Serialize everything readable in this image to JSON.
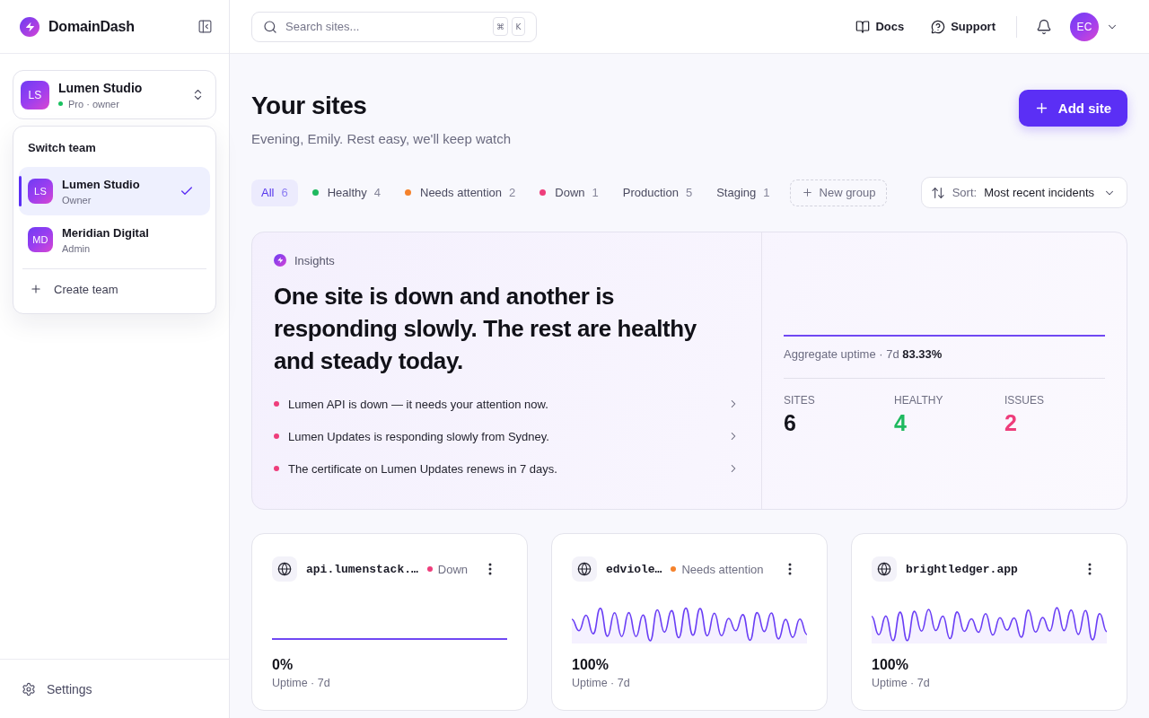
{
  "sidebar": {
    "brand": "DomainDash",
    "team_switcher": {
      "initials": "LS",
      "name": "Lumen Studio",
      "plan": "Pro · owner"
    },
    "team_menu": {
      "title": "Switch team",
      "teams": [
        {
          "initials": "LS",
          "name": "Lumen Studio",
          "role": "Owner",
          "selected": true
        },
        {
          "initials": "MD",
          "name": "Meridian Digital",
          "role": "Admin",
          "selected": false
        }
      ],
      "create_label": "Create team"
    },
    "settings_label": "Settings"
  },
  "topbar": {
    "search": {
      "placeholder": "Search sites...",
      "shortcut": [
        "⌘",
        "K"
      ]
    },
    "links": [
      {
        "kind": "docs",
        "label": "Docs"
      },
      {
        "kind": "support",
        "label": "Support"
      }
    ],
    "user_initials": "EC"
  },
  "header": {
    "title": "Your sites",
    "subtitle": "Evening, Emily. Rest easy, we'll keep watch",
    "add_button": "Add site"
  },
  "filters": {
    "tabs": [
      {
        "label": "All",
        "count": "6",
        "selected": true
      },
      {
        "label": "Healthy",
        "count": "4",
        "color": "#1fb95f",
        "selected": false
      },
      {
        "label": "Needs attention",
        "count": "2",
        "color": "#f5822c",
        "selected": false
      },
      {
        "label": "Down",
        "count": "1",
        "color": "#ee3d7b",
        "selected": false
      },
      {
        "label": "Production",
        "count": "5",
        "selected": false
      },
      {
        "label": "Staging",
        "count": "1",
        "selected": false
      }
    ],
    "new_group": "New group",
    "sort": {
      "label": "Sort:",
      "value": "Most recent incidents"
    }
  },
  "insights": {
    "label": "Insights",
    "headline": "One site is down and another is responding slowly. The rest are healthy and steady today.",
    "items": [
      "Lumen API is down — it needs your attention now.",
      "Lumen Updates is responding slowly from Sydney.",
      "The certificate on Lumen Updates renews in 7 days."
    ],
    "aggregate": {
      "kind": "flat",
      "caption": "Aggregate uptime · 7d **83.33%**"
    },
    "stats": [
      {
        "label": "SITES",
        "value": "6",
        "color": "#14141c"
      },
      {
        "label": "HEALTHY",
        "value": "4",
        "color": "#1fb95f"
      },
      {
        "label": "ISSUES",
        "value": "2",
        "color": "#ee3d7b"
      }
    ]
  },
  "sites": [
    {
      "kind": "flat",
      "domain": "api.lumenstack.…",
      "status": {
        "label": "Down",
        "color": "#ee3d7b"
      },
      "uptime": "0%",
      "uptime_label": "Uptime · 7d"
    },
    {
      "kind": "wave",
      "domain": "edviole…",
      "status": {
        "label": "Needs attention",
        "color": "#f5822c"
      },
      "uptime": "100%",
      "uptime_label": "Uptime · 7d"
    },
    {
      "kind": "wave",
      "domain": "brightledger.app",
      "uptime": "100%",
      "uptime_label": "Uptime · 7d"
    }
  ]
}
